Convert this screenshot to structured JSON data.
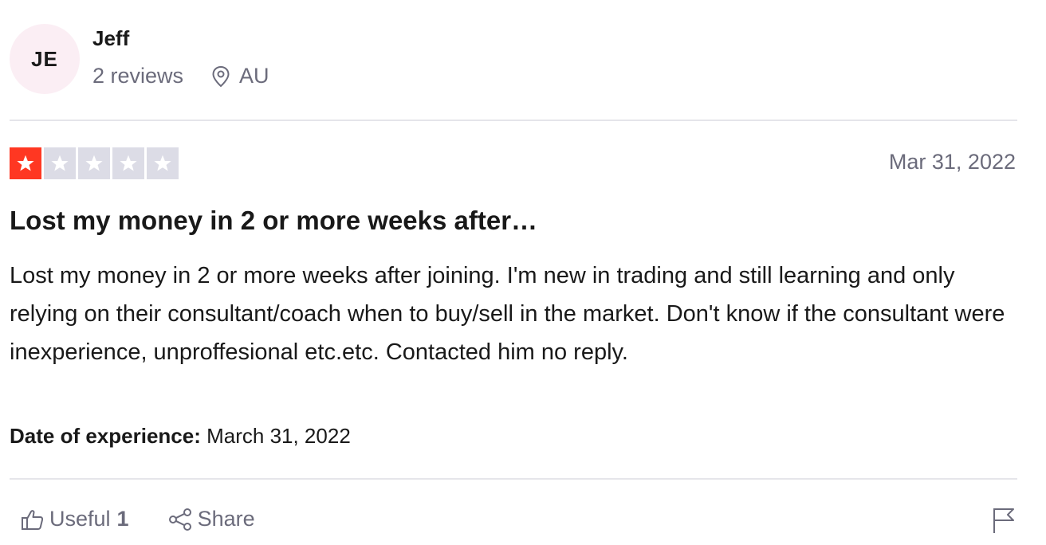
{
  "reviewer": {
    "initials": "JE",
    "name": "Jeff",
    "reviews_count": "2 reviews",
    "country": "AU",
    "avatar_color": "#fbeef4"
  },
  "review": {
    "rating": 1,
    "max_rating": 5,
    "star_color": "#ff3722",
    "date": "Mar 31, 2022",
    "title": "Lost my money in 2 or more weeks after…",
    "body": "Lost my money in 2 or more weeks after joining. I'm new in trading and still learning and only relying on their consultant/coach when to buy/sell in the market. Don't know if the consultant were inexperience, unproffesional etc.etc. Contacted him no reply.",
    "experience_label": "Date of experience:",
    "experience_date": "March 31, 2022"
  },
  "actions": {
    "useful_label": "Useful",
    "useful_count": "1",
    "share_label": "Share",
    "useful_icon": "thumbs-up-icon",
    "share_icon": "share-icon",
    "flag_icon": "flag-icon"
  }
}
